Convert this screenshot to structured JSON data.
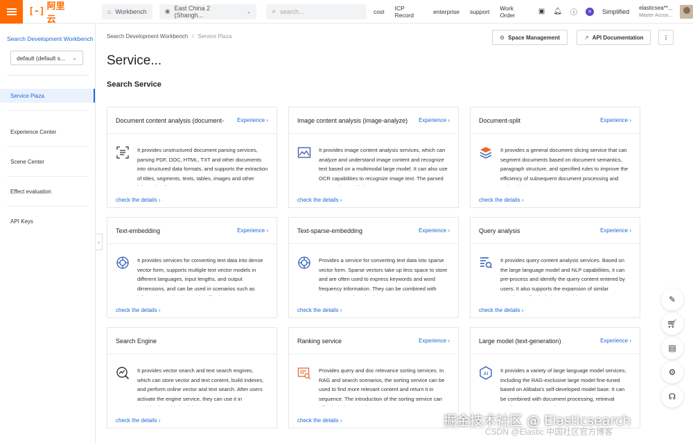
{
  "topbar": {
    "brand": "阿里云",
    "workbench": "Workbench",
    "region": "East China 2 (Shangh...",
    "search_placeholder": "search...",
    "links": [
      "cost",
      "ICP Record",
      "enterprise",
      "support",
      "Work Order"
    ],
    "language": "Simplified",
    "account_name": "elasticsea**...",
    "account_role": "Master Accou..."
  },
  "sidebar": {
    "title": "Search Development Workbench",
    "workspace": "default (default s...",
    "items": [
      {
        "label": "Service Plaza",
        "active": true
      },
      {
        "label": "Experience Center",
        "active": false
      },
      {
        "label": "Scene Center",
        "active": false
      },
      {
        "label": "Effect evaluation",
        "active": false
      },
      {
        "label": "API Keys",
        "active": false
      }
    ]
  },
  "main": {
    "breadcrumb": [
      "Search Development Workbench",
      "Service Plaza"
    ],
    "space_management": "Space Management",
    "api_documentation": "API Documentation",
    "page_title": "Service...",
    "section_title": "Search Service",
    "experience_label": "Experience",
    "details_label": "check the details",
    "cards": [
      {
        "name": "Document content analysis (document-",
        "icon": "document-scan-icon",
        "desc": "It provides unstructured document parsing services, parsing PDF, DOC, HTML, TXT and other documents into structured data formats, and supports the extraction of titles, segments, texts, tables, images and other information from papers,"
      },
      {
        "name": "Image content analysis (image-analyze)",
        "icon": "image-icon",
        "desc": "It provides image content analysis services, which can analyze and understand image content and recognize text based on a multimodal large model. It can also use OCR capabilities to recognize image text. The parsed text can be used in image"
      },
      {
        "name": "Document-split",
        "icon": "layers-icon",
        "desc": "It provides a general document slicing service that can segment documents based on document semantics, paragraph structure, and specified rules to improve the efficiency of subsequent document processing and retrieval. The output"
      },
      {
        "name": "Text-embedding",
        "icon": "embedding-icon",
        "desc": "It provides services for converting text data into dense vector form, supports multiple text vector models in different languages, input lengths, and output dimensions, and can be used in scenarios such as information retrieval, text classification,"
      },
      {
        "name": "Text-sparse-embedding",
        "icon": "sparse-embedding-icon",
        "desc": "Provides a service for converting text data into sparse vector form. Sparse vectors take up less space to store and are often used to express keywords and word frequency information. They can be combined with dense vectors for mixed"
      },
      {
        "name": "Query analysis",
        "icon": "query-analysis-icon",
        "desc": "It provides query content analysis services. Based on the large language model and NLP capabilities, it can pre-process and identify the query content entered by users. It also supports the expansion of similar questions, effectively improving the"
      },
      {
        "name": "Search Engine",
        "icon": "search-engine-icon",
        "desc": "It provides vector search and text search engines, which can store vector and text content, build indexes, and perform online vector and text search. After users activate the engine service, they can use it in combination with the rich API"
      },
      {
        "name": "Ranking service",
        "icon": "ranking-icon",
        "desc": "Provides query and doc relevance sorting services. In RAG and search scenarios, the sorting service can be used to find more relevant content and return it in sequence. The introduction of the sorting service can effectively improve the"
      },
      {
        "name": "Large model (text-generation)",
        "icon": "ai-model-icon",
        "desc": "It provides a variety of large language model services, including the RAG-exclusive large model fine-tuned based on Alibaba's self-developed model base. It can be combined with document processing, retrieval services, etc., and can be"
      }
    ]
  },
  "watermark": {
    "line1": "掘金技术社区 @ Elasticsearch",
    "line2": "CSDN @Elastic 中国社区官方博客"
  },
  "colors": {
    "accent": "#1a67d8",
    "brand": "#ff6a00",
    "icon_orange": "#e8692a"
  }
}
